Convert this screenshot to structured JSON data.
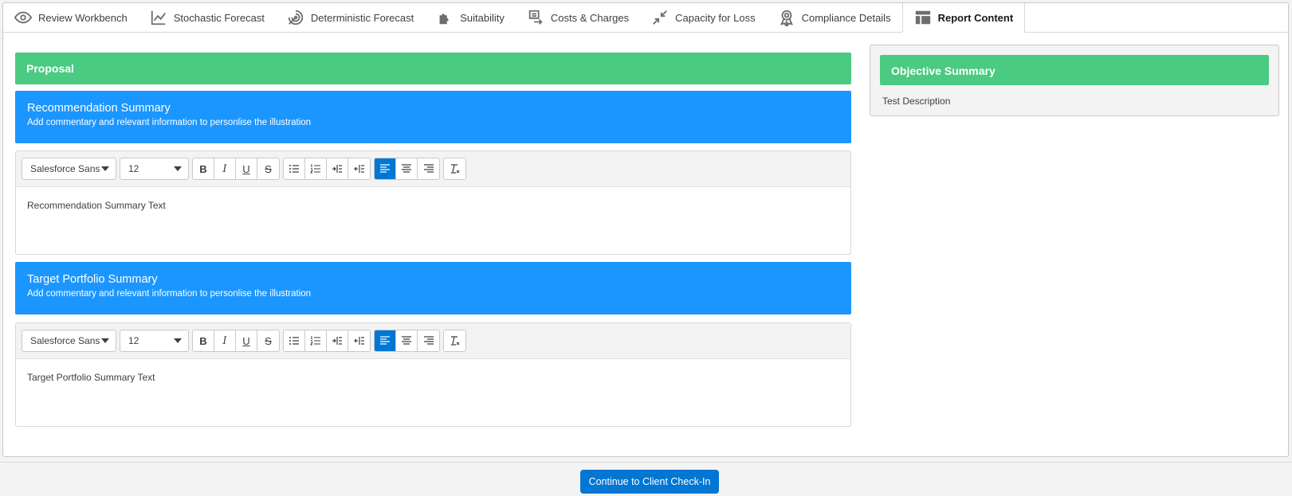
{
  "tabs": [
    {
      "label": "Review Workbench",
      "icon": "eye-icon"
    },
    {
      "label": "Stochastic Forecast",
      "icon": "line-chart-icon"
    },
    {
      "label": "Deterministic Forecast",
      "icon": "radar-icon"
    },
    {
      "label": "Suitability",
      "icon": "puzzle-icon"
    },
    {
      "label": "Costs & Charges",
      "icon": "list-arrow-icon"
    },
    {
      "label": "Capacity for Loss",
      "icon": "collapse-arrows-icon"
    },
    {
      "label": "Compliance Details",
      "icon": "award-icon"
    },
    {
      "label": "Report Content",
      "icon": "layout-icon"
    }
  ],
  "active_tab": "Report Content",
  "proposal": {
    "title": "Proposal"
  },
  "recommendation": {
    "title": "Recommendation Summary",
    "subtitle": "Add commentary and relevant information to personlise the illustration",
    "font": "Salesforce Sans",
    "size": "12",
    "text": "Recommendation Summary Text"
  },
  "target": {
    "title": "Target Portfolio Summary",
    "subtitle": "Add commentary and relevant information to personlise the illustration",
    "font": "Salesforce Sans",
    "size": "12",
    "text": "Target Portfolio Summary Text"
  },
  "objective": {
    "title": "Objective Summary",
    "description": "Test Description"
  },
  "footer": {
    "continue_label": "Continue to Client Check-In"
  },
  "colors": {
    "green": "#4bca81",
    "blue_header": "#1b96ff",
    "brand": "#0176d3"
  }
}
